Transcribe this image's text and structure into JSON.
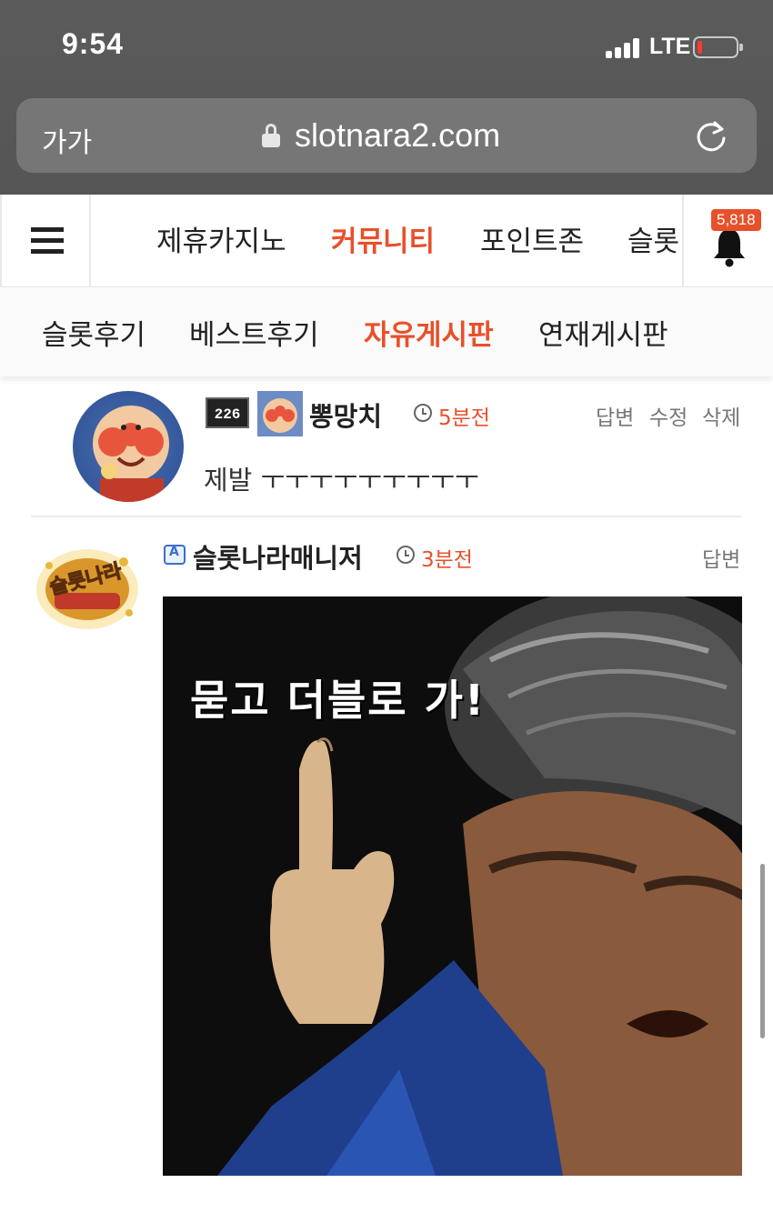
{
  "status_bar": {
    "time": "9:54",
    "network": "LTE",
    "battery_color": "#ff3b30"
  },
  "browser": {
    "text_size_label": "가가",
    "url": "slotnara2.com"
  },
  "main_nav": {
    "tabs": [
      {
        "label": "제휴카지노"
      },
      {
        "label": "커뮤니티",
        "active": true
      },
      {
        "label": "포인트존"
      },
      {
        "label": "슬롯"
      }
    ],
    "notification_count": "5,818"
  },
  "sub_nav": {
    "tabs": [
      {
        "label": "슬롯후기"
      },
      {
        "label": "베스트후기"
      },
      {
        "label": "자유게시판",
        "active": true
      },
      {
        "label": "연재게시판"
      }
    ]
  },
  "comments": [
    {
      "level": "226",
      "username": "뽕망치",
      "time_ago": "5분전",
      "actions": [
        "답변",
        "수정",
        "삭제"
      ],
      "text": "제발 ㅜㅜㅜㅜㅜㅜㅜㅜㅜ"
    },
    {
      "avatar_text": "슬롯나라",
      "username": "슬롯나라매니저",
      "time_ago": "3분전",
      "actions": [
        "답변"
      ],
      "image_caption": "묻고 더블로 가!"
    }
  ],
  "colors": {
    "accent": "#e8502a",
    "text": "#222222",
    "muted": "#777777"
  }
}
